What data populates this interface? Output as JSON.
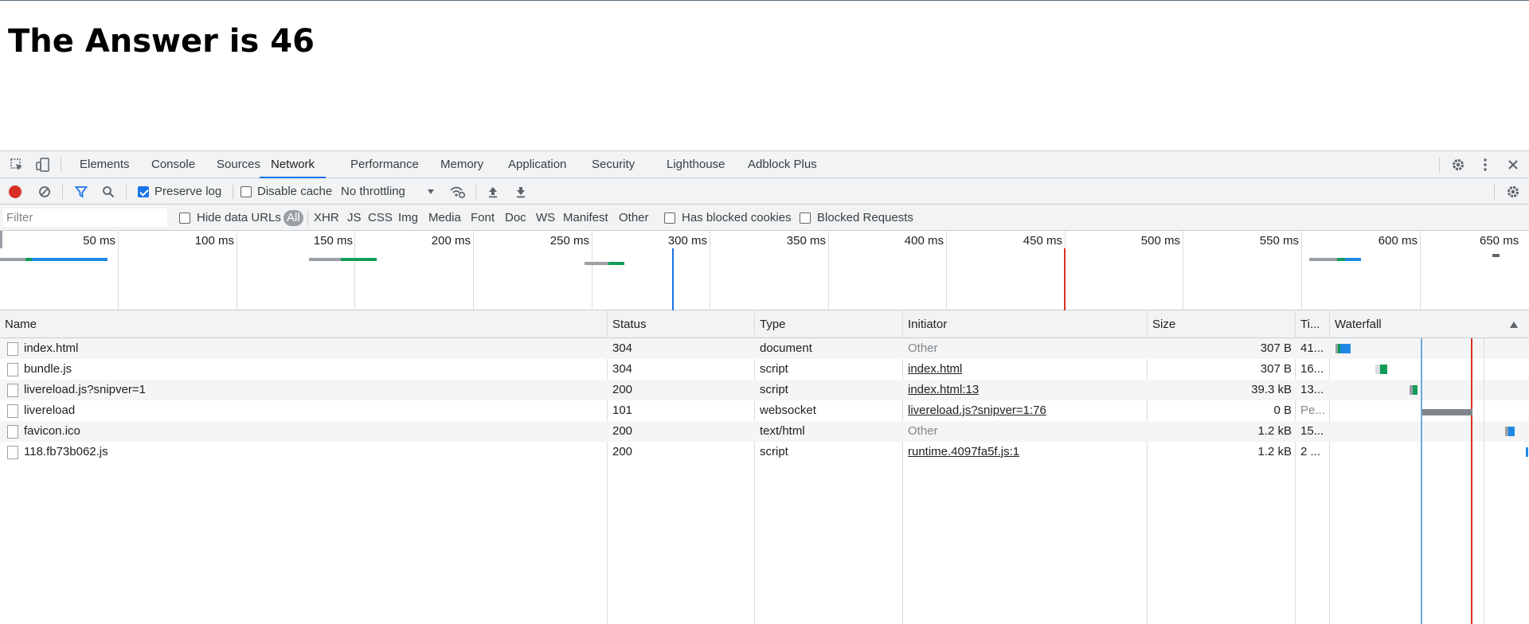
{
  "page": {
    "heading": "The Answer is 46"
  },
  "devtools": {
    "tabs": [
      "Elements",
      "Console",
      "Sources",
      "Network",
      "Performance",
      "Memory",
      "Application",
      "Security",
      "Lighthouse",
      "Adblock Plus"
    ],
    "active_tab": "Network",
    "toolbar": {
      "preserve_log_label": "Preserve log",
      "preserve_log_checked": true,
      "disable_cache_label": "Disable cache",
      "disable_cache_checked": false,
      "throttling_value": "No throttling"
    },
    "filter": {
      "placeholder": "Filter",
      "hide_data_urls_label": "Hide data URLs",
      "types": [
        "All",
        "XHR",
        "JS",
        "CSS",
        "Img",
        "Media",
        "Font",
        "Doc",
        "WS",
        "Manifest",
        "Other"
      ],
      "active_type": "All",
      "has_blocked_cookies_label": "Has blocked cookies",
      "blocked_requests_label": "Blocked Requests"
    },
    "overview": {
      "ticks": [
        "50 ms",
        "100 ms",
        "150 ms",
        "200 ms",
        "250 ms",
        "300 ms",
        "350 ms",
        "400 ms",
        "450 ms",
        "500 ms",
        "550 ms",
        "600 ms",
        "650 ms"
      ],
      "dom_content_loaded_ms": 290,
      "load_ms": 450,
      "colors": {
        "dom_content_loaded": "#1a73e8",
        "load": "#d93025",
        "waiting": "#9aa0a6",
        "download": "#1e88e5",
        "download_alt": "#0f9d58"
      }
    },
    "table": {
      "columns": [
        "Name",
        "Status",
        "Type",
        "Initiator",
        "Size",
        "Ti...",
        "Waterfall"
      ],
      "rows": [
        {
          "name": "index.html",
          "status": "304",
          "type": "document",
          "initiator": "Other",
          "initiator_link": false,
          "size": "307 B",
          "time": "41..."
        },
        {
          "name": "bundle.js",
          "status": "304",
          "type": "script",
          "initiator": "index.html",
          "initiator_link": true,
          "size": "307 B",
          "time": "16..."
        },
        {
          "name": "livereload.js?snipver=1",
          "status": "200",
          "type": "script",
          "initiator": "index.html:13",
          "initiator_link": true,
          "size": "39.3 kB",
          "time": "13..."
        },
        {
          "name": "livereload",
          "status": "101",
          "type": "websocket",
          "initiator": "livereload.js?snipver=1:76",
          "initiator_link": true,
          "size": "0 B",
          "time": "Pe..."
        },
        {
          "name": "favicon.ico",
          "status": "200",
          "type": "text/html",
          "initiator": "Other",
          "initiator_link": false,
          "size": "1.2 kB",
          "time": "15..."
        },
        {
          "name": "118.fb73b062.js",
          "status": "200",
          "type": "script",
          "initiator": "runtime.4097fa5f.js:1",
          "initiator_link": true,
          "size": "1.2 kB",
          "time": "2 ..."
        }
      ]
    }
  }
}
